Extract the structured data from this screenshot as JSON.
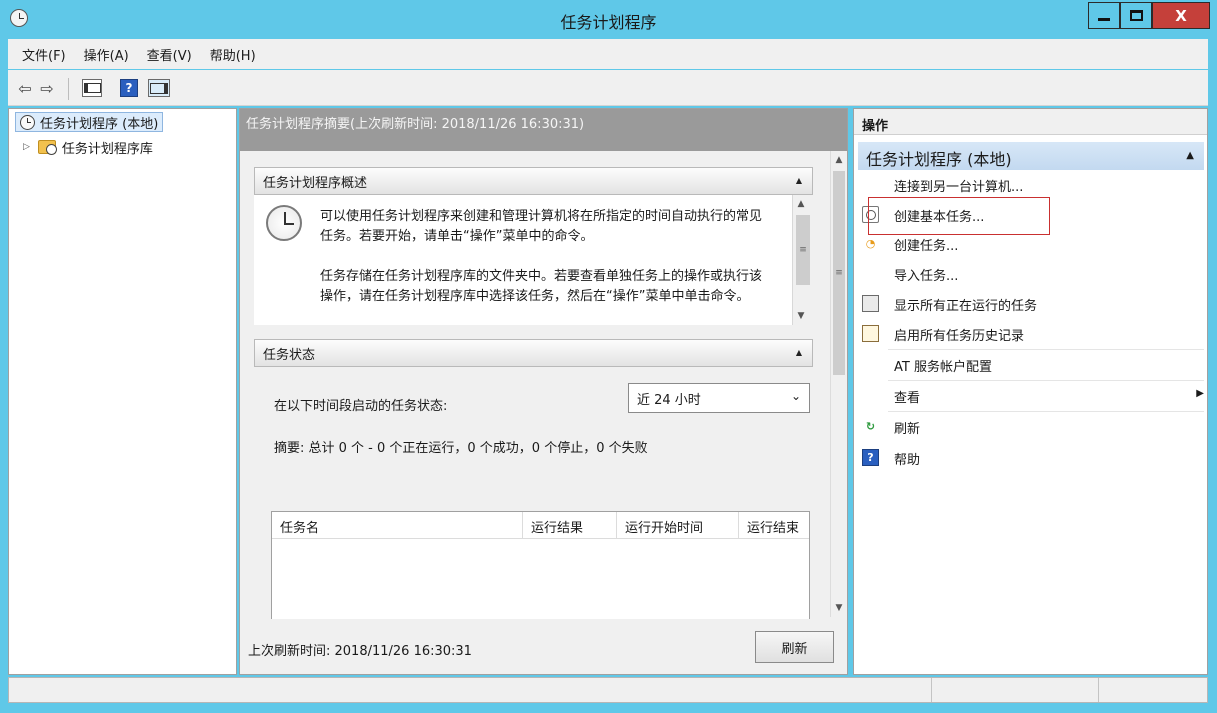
{
  "window": {
    "title": "任务计划程序",
    "close_glyph": "X"
  },
  "menu": [
    "文件(F)",
    "操作(A)",
    "查看(V)",
    "帮助(H)"
  ],
  "toolbar": {
    "back_glyph": "⇦",
    "forward_glyph": "⇨",
    "help_glyph": "?"
  },
  "tree": {
    "root_label": "任务计划程序 (本地)",
    "child_label": "任务计划程序库",
    "expand_glyph": "▷"
  },
  "center": {
    "header": "任务计划程序摘要(上次刷新时间: 2018/11/26 16:30:31)",
    "overview_title": "任务计划程序概述",
    "overview_paragraph1": "可以使用任务计划程序来创建和管理计算机将在所指定的时间自动执行的常见任务。若要开始，请单击“操作”菜单中的命令。",
    "overview_paragraph2": "任务存储在任务计划程序库的文件夹中。若要查看单独任务上的操作或执行该操作，请在任务计划程序库中选择该任务，然后在“操作”菜单中单击命令。",
    "status_title": "任务状态",
    "status_label": "在以下时间段启动的任务状态:",
    "period_value": "近 24 小时",
    "summary": "摘要: 总计 0 个 - 0 个正在运行，0 个成功，0 个停止，0 个失败",
    "columns": [
      "任务名",
      "运行结果",
      "运行开始时间",
      "运行结束"
    ],
    "last_refresh": "上次刷新时间: 2018/11/26 16:30:31",
    "refresh_button": "刷新"
  },
  "actions": {
    "header": "操作",
    "group_title": "任务计划程序 (本地)",
    "items": [
      {
        "label": "连接到另一台计算机...",
        "icon": ""
      },
      {
        "label": "创建基本任务...",
        "icon": "basic-task-icon"
      },
      {
        "label": "创建任务...",
        "icon": "create-task-icon"
      },
      {
        "label": "导入任务...",
        "icon": ""
      },
      {
        "label": "显示所有正在运行的任务",
        "icon": "running-tasks-icon"
      },
      {
        "label": "启用所有任务历史记录",
        "icon": "history-icon"
      },
      {
        "label": "AT 服务帐户配置",
        "icon": ""
      },
      {
        "label": "查看",
        "icon": ""
      },
      {
        "label": "刷新",
        "icon": "refresh-icon"
      },
      {
        "label": "帮助",
        "icon": "help-icon"
      }
    ],
    "highlight_color": "#c93030"
  },
  "colors": {
    "frame": "#5fc8e8",
    "close_button": "#c5403a",
    "center_header": "#9a9a9a",
    "selection": "#dcecfc"
  }
}
